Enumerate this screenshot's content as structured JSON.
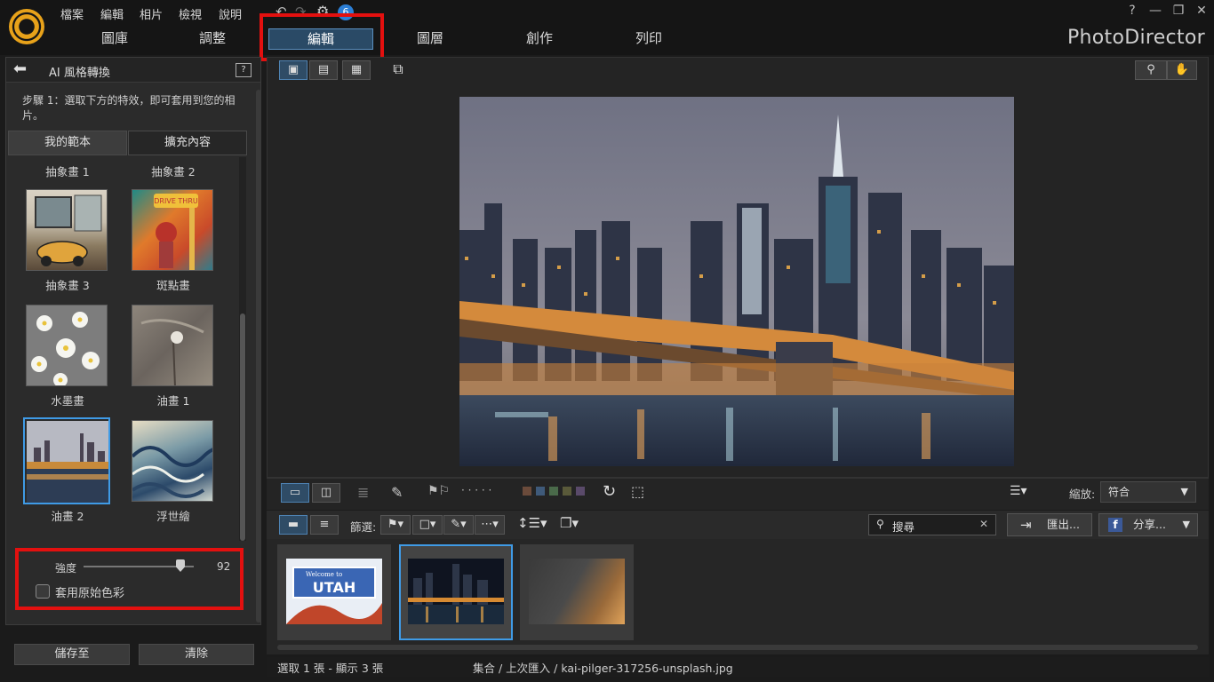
{
  "menu": [
    "檔案",
    "編輯",
    "相片",
    "檢視",
    "說明"
  ],
  "main_tabs": [
    "圖庫",
    "調整",
    "編輯",
    "圖層",
    "創作",
    "列印"
  ],
  "brand": "PhotoDirector",
  "window_controls": {
    "help": "?",
    "minimize": "—",
    "restore": "❐",
    "close": "✕"
  },
  "panel": {
    "title": "AI 風格轉換",
    "help_icon": "?",
    "step_text": "步驟 1：選取下方的特效，即可套用到您的相片。",
    "subtabs": [
      "我的範本",
      "擴充內容"
    ],
    "row0_labels": [
      "抽象畫 1",
      "抽象畫 2"
    ],
    "styles": [
      {
        "label": "抽象畫 3"
      },
      {
        "label": "斑點畫"
      },
      {
        "label": "水墨畫"
      },
      {
        "label": "油畫 1"
      },
      {
        "label": "油畫 2",
        "selected": true
      },
      {
        "label": "浮世繪"
      }
    ],
    "strength_label": "強度",
    "strength_value": "92",
    "strength": 92,
    "orig_color_label": "套用原始色彩",
    "save_label": "儲存至",
    "clear_label": "清除"
  },
  "toolbar": {
    "zoom_label": "縮放:",
    "zoom_value": "符合",
    "filter_label": "篩選:",
    "search_placeholder": "搜尋",
    "export_label": "匯出...",
    "share_label": "分享...",
    "dots": "· · · · ·",
    "swatch_colors": [
      "#6b4b3b",
      "#3f5a7a",
      "#4a6a4a",
      "#5a5a3a",
      "#5a4a6a"
    ]
  },
  "status": {
    "selection": "選取 1 張 - 顯示 3 張",
    "path": "集合 / 上次匯入 / kai-pilger-317256-unsplash.jpg"
  },
  "filmstrip": {
    "utah_text": "UTAH",
    "utah_welcome": "Welcome to"
  }
}
